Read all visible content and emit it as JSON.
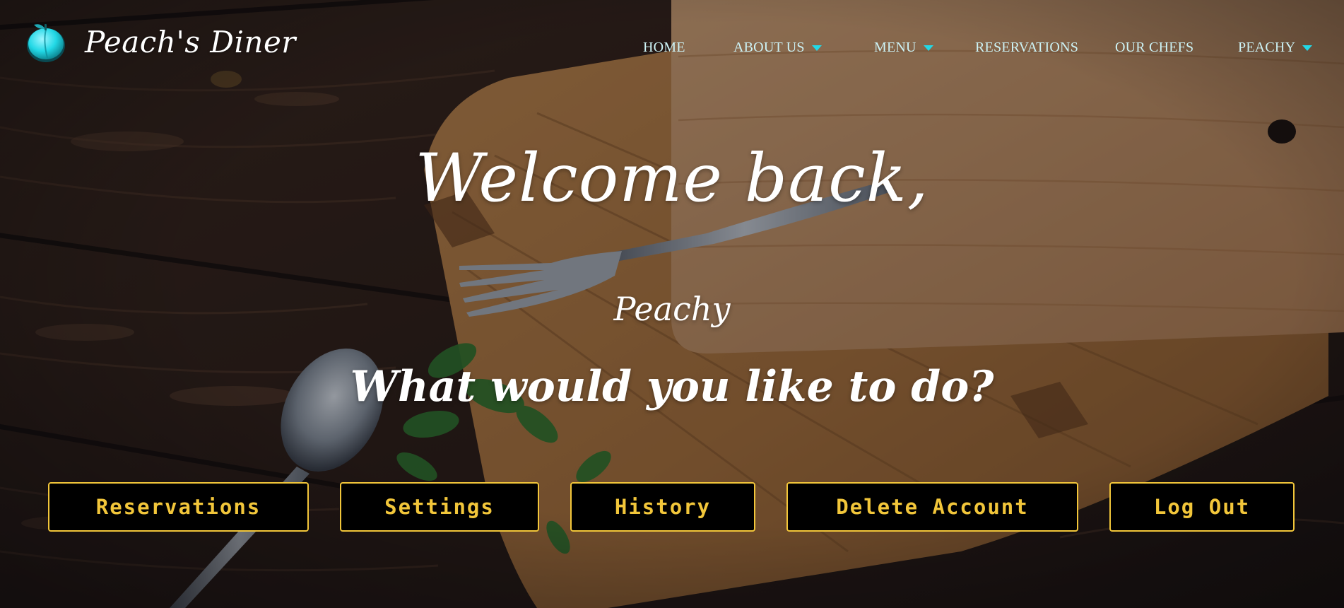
{
  "brand": {
    "name": "Peach's Diner",
    "logo_icon": "peach-icon",
    "logo_color": "#22d8e6"
  },
  "nav": {
    "items": [
      {
        "label": "HOME",
        "has_dropdown": false
      },
      {
        "label": "ABOUT US",
        "has_dropdown": true
      },
      {
        "label": "MENU",
        "has_dropdown": true
      },
      {
        "label": "RESERVATIONS",
        "has_dropdown": false
      },
      {
        "label": "OUR CHEFS",
        "has_dropdown": false
      },
      {
        "label": "PEACHY",
        "has_dropdown": true
      }
    ],
    "text_color": "#cdf3f6",
    "caret_color": "#22d8e6"
  },
  "hero": {
    "welcome": "Welcome back,",
    "username": "Peachy",
    "prompt": "What would you like to do?"
  },
  "actions": [
    {
      "label": "Reservations"
    },
    {
      "label": "Settings"
    },
    {
      "label": "History"
    },
    {
      "label": "Delete Account"
    },
    {
      "label": "Log Out"
    }
  ],
  "colors": {
    "button_accent": "#f2c63a",
    "button_background": "#000000",
    "hero_text": "#ffffff"
  }
}
